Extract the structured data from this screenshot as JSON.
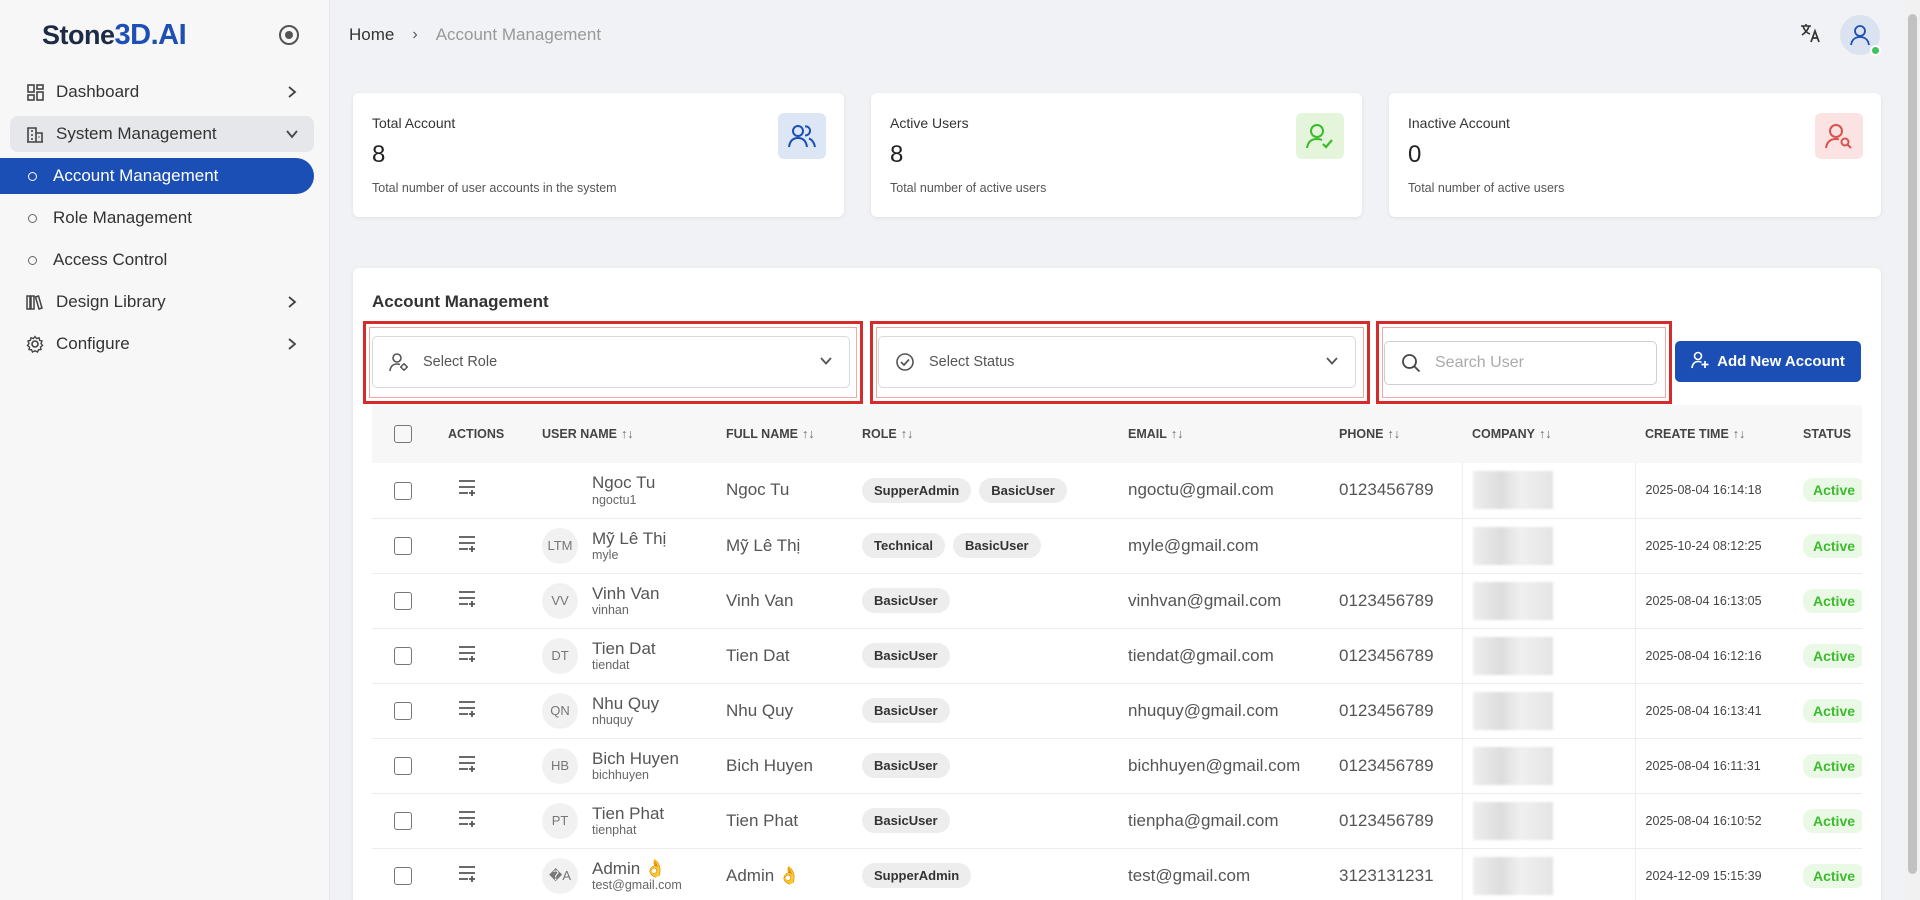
{
  "sidebar": {
    "logo_a": "Stone",
    "logo_b": "3D.AI",
    "items": [
      {
        "label": "Dashboard"
      },
      {
        "label": "System Management"
      },
      {
        "label": "Design Library"
      },
      {
        "label": "Configure"
      }
    ],
    "sub_items": [
      {
        "label": "Account Management"
      },
      {
        "label": "Role Management"
      },
      {
        "label": "Access Control"
      }
    ]
  },
  "breadcrumb": {
    "home": "Home",
    "sep": "›",
    "current": "Account Management"
  },
  "stats": [
    {
      "title": "Total Account",
      "value": "8",
      "desc": "Total number of user accounts in the system",
      "color": "#dde6f5",
      "icon": "users-icon"
    },
    {
      "title": "Active Users",
      "value": "8",
      "desc": "Total number of active users",
      "color": "#e4f5dc",
      "icon": "user-check-icon"
    },
    {
      "title": "Inactive Account",
      "value": "0",
      "desc": "Total number of active users",
      "color": "#fbe3e3",
      "icon": "user-search-icon"
    }
  ],
  "panel": {
    "title": "Account Management",
    "role_placeholder": "Select Role",
    "status_placeholder": "Select Status",
    "search_placeholder": "Search User",
    "add_label": "Add New Account"
  },
  "table": {
    "columns": [
      "ACTIONS",
      "USER NAME",
      "FULL NAME",
      "ROLE",
      "EMAIL",
      "PHONE",
      "COMPANY",
      "CREATE TIME",
      "STATUS"
    ],
    "sort_glyph": "↑↓",
    "rows": [
      {
        "initials": "",
        "name": "Ngoc Tu",
        "user": "ngoctu1",
        "full": "Ngoc Tu",
        "roles": [
          "SupperAdmin",
          "BasicUser"
        ],
        "email": "ngoctu@gmail.com",
        "phone": "0123456789",
        "time": "2025-08-04 16:14:18",
        "status": "Active"
      },
      {
        "initials": "LTM",
        "name": "Mỹ Lê Thị",
        "user": "myle",
        "full": "Mỹ Lê Thị",
        "roles": [
          "Technical",
          "BasicUser"
        ],
        "email": "myle@gmail.com",
        "phone": "",
        "time": "2025-10-24 08:12:25",
        "status": "Active"
      },
      {
        "initials": "VV",
        "name": "Vinh Van",
        "user": "vinhan",
        "full": "Vinh Van",
        "roles": [
          "BasicUser"
        ],
        "email": "vinhvan@gmail.com",
        "phone": "0123456789",
        "time": "2025-08-04 16:13:05",
        "status": "Active"
      },
      {
        "initials": "DT",
        "name": "Tien Dat",
        "user": "tiendat",
        "full": "Tien Dat",
        "roles": [
          "BasicUser"
        ],
        "email": "tiendat@gmail.com",
        "phone": "0123456789",
        "time": "2025-08-04 16:12:16",
        "status": "Active"
      },
      {
        "initials": "QN",
        "name": "Nhu Quy",
        "user": "nhuquy",
        "full": "Nhu Quy",
        "roles": [
          "BasicUser"
        ],
        "email": "nhuquy@gmail.com",
        "phone": "0123456789",
        "time": "2025-08-04 16:13:41",
        "status": "Active"
      },
      {
        "initials": "HB",
        "name": "Bich Huyen",
        "user": "bichhuyen",
        "full": "Bich Huyen",
        "roles": [
          "BasicUser"
        ],
        "email": "bichhuyen@gmail.com",
        "phone": "0123456789",
        "time": "2025-08-04 16:11:31",
        "status": "Active"
      },
      {
        "initials": "PT",
        "name": "Tien Phat",
        "user": "tienphat",
        "full": "Tien Phat",
        "roles": [
          "BasicUser"
        ],
        "email": "tienpha@gmail.com",
        "phone": "0123456789",
        "time": "2025-08-04 16:10:52",
        "status": "Active"
      },
      {
        "initials": "�A",
        "name": "Admin 👌",
        "user": "test@gmail.com",
        "full": "Admin 👌",
        "roles": [
          "SupperAdmin"
        ],
        "email": "test@gmail.com",
        "phone": "3123131231",
        "time": "2024-12-09 15:15:39",
        "status": "Active"
      }
    ]
  }
}
